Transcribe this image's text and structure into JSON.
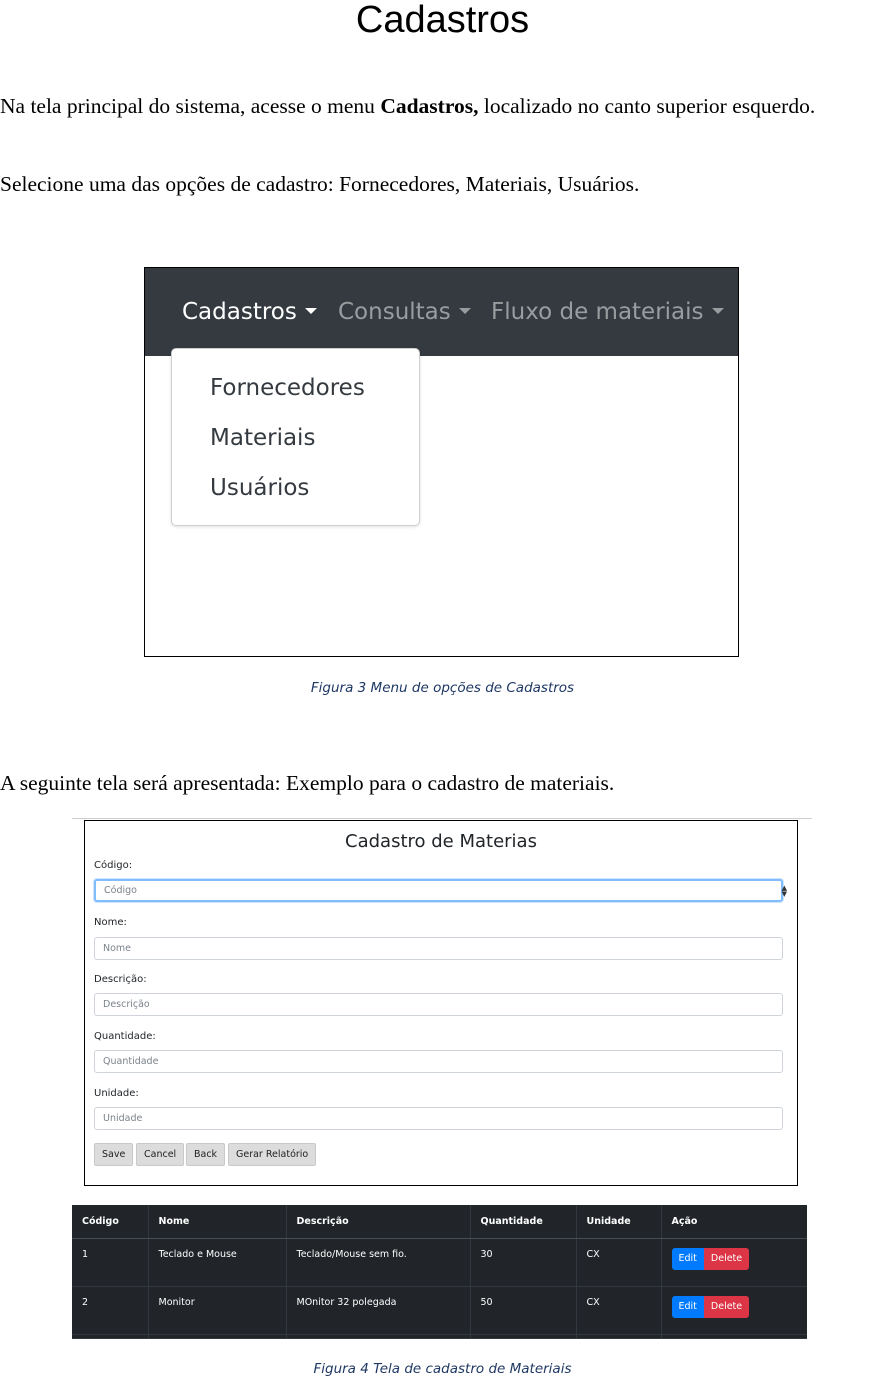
{
  "document": {
    "title": "Cadastros",
    "paragraph1_before": "Na tela principal do sistema, acesse o menu ",
    "paragraph1_bold": "Cadastros,",
    "paragraph1_after": " localizado no canto superior esquerdo.",
    "paragraph2": "Selecione uma das opções de cadastro: Fornecedores, Materiais, Usuários.",
    "paragraph3": "A seguinte tela será apresentada: Exemplo para o cadastro de materiais."
  },
  "figure3": {
    "navbar": {
      "items": [
        "Cadastros",
        "Consultas",
        "Fluxo de materiais"
      ]
    },
    "dropdown": {
      "items": [
        "Fornecedores",
        "Materiais",
        "Usuários"
      ]
    },
    "caption": "Figura 3 Menu de opções de Cadastros"
  },
  "figure4": {
    "form": {
      "title": "Cadastro de Materias",
      "fields": [
        {
          "label": "Código:",
          "placeholder": "Código"
        },
        {
          "label": "Nome:",
          "placeholder": "Nome"
        },
        {
          "label": "Descrição:",
          "placeholder": "Descrição"
        },
        {
          "label": "Quantidade:",
          "placeholder": "Quantidade"
        },
        {
          "label": "Unidade:",
          "placeholder": "Unidade"
        }
      ],
      "buttons": {
        "save": "Save",
        "cancel": "Cancel",
        "back": "Back",
        "report": "Gerar Relatório"
      }
    },
    "table": {
      "headers": [
        "Código",
        "Nome",
        "Descrição",
        "Quantidade",
        "Unidade",
        "Ação"
      ],
      "rows": [
        {
          "codigo": "1",
          "nome": "Teclado e Mouse",
          "descricao": "Teclado/Mouse sem fio.",
          "quantidade": "30",
          "unidade": "CX"
        },
        {
          "codigo": "2",
          "nome": "Monitor",
          "descricao": "MOnitor 32 polegada",
          "quantidade": "50",
          "unidade": "CX"
        }
      ],
      "action_labels": {
        "edit": "Edit",
        "delete": "Delete"
      }
    },
    "caption": "Figura 4 Tela de cadastro de Materiais"
  },
  "colors": {
    "navbar_bg": "#343a40",
    "table_bg": "#212529",
    "edit_button": "#007bff",
    "delete_button": "#dc3545",
    "caption": "#1f3864"
  }
}
